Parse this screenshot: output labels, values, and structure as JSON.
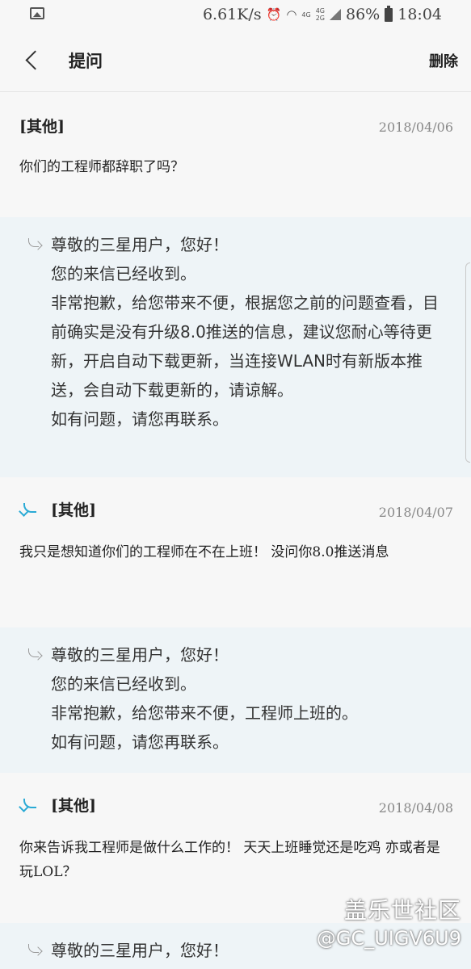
{
  "status_bar": {
    "speed": "6.61K/s",
    "network_top": "4G",
    "network_mid": "4G",
    "network_low": "2G",
    "battery": "86%",
    "time": "18:04"
  },
  "header": {
    "title": "提问",
    "delete_label": "删除"
  },
  "thread": [
    {
      "type": "question",
      "category": "[其他]",
      "date": "2018/04/06",
      "text": "你们的工程师都辞职了吗？"
    },
    {
      "type": "answer",
      "lines": [
        "尊敬的三星用户，您好！",
        "您的来信已经收到。",
        "非常抱歉，给您带来不便，根据您之前的问题查看，目前确实是没有升级8.0推送的信息，建议您耐心等待更新，开启自动下载更新，当连接WLAN时有新版本推送，会自动下载更新的，请谅解。",
        "如有问题，请您再联系。"
      ]
    },
    {
      "type": "question",
      "category": "[其他]",
      "date": "2018/04/07",
      "text": "我只是想知道你们的工程师在不在上班！  没问你8.0推送消息"
    },
    {
      "type": "answer",
      "lines": [
        "尊敬的三星用户，您好！",
        "您的来信已经收到。",
        "非常抱歉，给您带来不便，工程师上班的。",
        "如有问题，请您再联系。"
      ]
    },
    {
      "type": "question",
      "category": "[其他]",
      "date": "2018/04/08",
      "text": "你来告诉我工程师是做什么工作的！  天天上班睡觉还是吃鸡  亦或者是玩LOL？"
    },
    {
      "type": "answer",
      "lines": [
        "尊敬的三星用户，您好！"
      ]
    }
  ],
  "watermark": {
    "brand": "盖乐世社区",
    "user": "@GC_UIGV6U9"
  },
  "colors": {
    "answer_bg": "#eef4f7",
    "followup_accent": "#2aaad5"
  }
}
